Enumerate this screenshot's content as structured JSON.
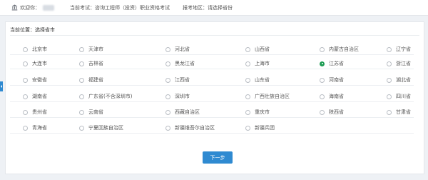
{
  "header": {
    "welcome_label": "欢迎你：",
    "exam_label": "当前考试：",
    "exam_value": "咨询工程师（投资）职业资格考试",
    "area_label": "报考地区：",
    "area_value": "请选择省份"
  },
  "panel": {
    "title": "当前位置：选择省市"
  },
  "regions": [
    [
      {
        "name": "北京市",
        "selected": false
      },
      {
        "name": "天津市",
        "selected": false
      },
      {
        "name": "河北省",
        "selected": false
      },
      {
        "name": "山西省",
        "selected": false
      },
      {
        "name": "内蒙古自治区",
        "selected": false
      },
      {
        "name": "辽宁省",
        "selected": false
      }
    ],
    [
      {
        "name": "大连市",
        "selected": false
      },
      {
        "name": "吉林省",
        "selected": false
      },
      {
        "name": "黑龙江省",
        "selected": false
      },
      {
        "name": "上海市",
        "selected": false
      },
      {
        "name": "江苏省",
        "selected": true
      },
      {
        "name": "浙江省",
        "selected": false
      }
    ],
    [
      {
        "name": "安徽省",
        "selected": false
      },
      {
        "name": "福建省",
        "selected": false
      },
      {
        "name": "江西省",
        "selected": false
      },
      {
        "name": "山东省",
        "selected": false
      },
      {
        "name": "河南省",
        "selected": false
      },
      {
        "name": "湖北省",
        "selected": false
      }
    ],
    [
      {
        "name": "湖南省",
        "selected": false
      },
      {
        "name": "广东省(不含深圳市)",
        "selected": false
      },
      {
        "name": "深圳市",
        "selected": false
      },
      {
        "name": "广西壮族自治区",
        "selected": false
      },
      {
        "name": "海南省",
        "selected": false
      },
      {
        "name": "四川省",
        "selected": false
      }
    ],
    [
      {
        "name": "贵州省",
        "selected": false
      },
      {
        "name": "云南省",
        "selected": false
      },
      {
        "name": "西藏自治区",
        "selected": false
      },
      {
        "name": "重庆市",
        "selected": false
      },
      {
        "name": "陕西省",
        "selected": false
      },
      {
        "name": "甘肃省",
        "selected": false
      }
    ],
    [
      {
        "name": "青海省",
        "selected": false
      },
      {
        "name": "宁夏回族自治区",
        "selected": false
      },
      {
        "name": "新疆维吾尔自治区",
        "selected": false
      },
      {
        "name": "新疆兵团",
        "selected": false
      }
    ]
  ],
  "actions": {
    "next_label": "下一步"
  },
  "colors": {
    "primary": "#2f8ad1",
    "selected_radio": "#1f9d55"
  },
  "icons": {
    "header": "bank-icon",
    "side_tab": "chevron-left-icon"
  }
}
